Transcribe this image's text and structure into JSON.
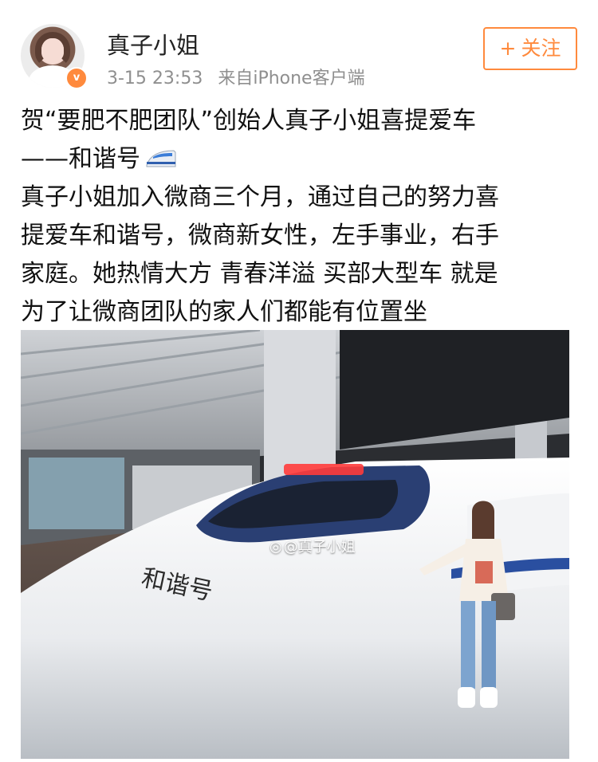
{
  "header": {
    "username": "真子小姐",
    "time": "3-15 23:53",
    "source": "来自iPhone客户端",
    "verified_badge": "v",
    "follow_label": "关注",
    "follow_icon": "plus-icon"
  },
  "post": {
    "line1": "贺“要肥不肥团队”创始人真子小姐喜提爱车",
    "line2": "——和谐号",
    "line2_icon": "train-emoji",
    "body": [
      "真子小姐加入微商三个月，通过自己的努力喜",
      "提爱车和谐号，微商新女性，左手事业，右手",
      "家庭。她热情大方 青春洋溢 买部大型车 就是",
      "为了让微商团队的家人们都能有位置坐"
    ]
  },
  "photo": {
    "watermark": "@真子小姐",
    "watermark_icon": "weibo-icon",
    "train_text": "和谐号"
  },
  "colors": {
    "accent": "#ff8a3d",
    "meta": "#8f8f8f",
    "text": "#111111"
  }
}
